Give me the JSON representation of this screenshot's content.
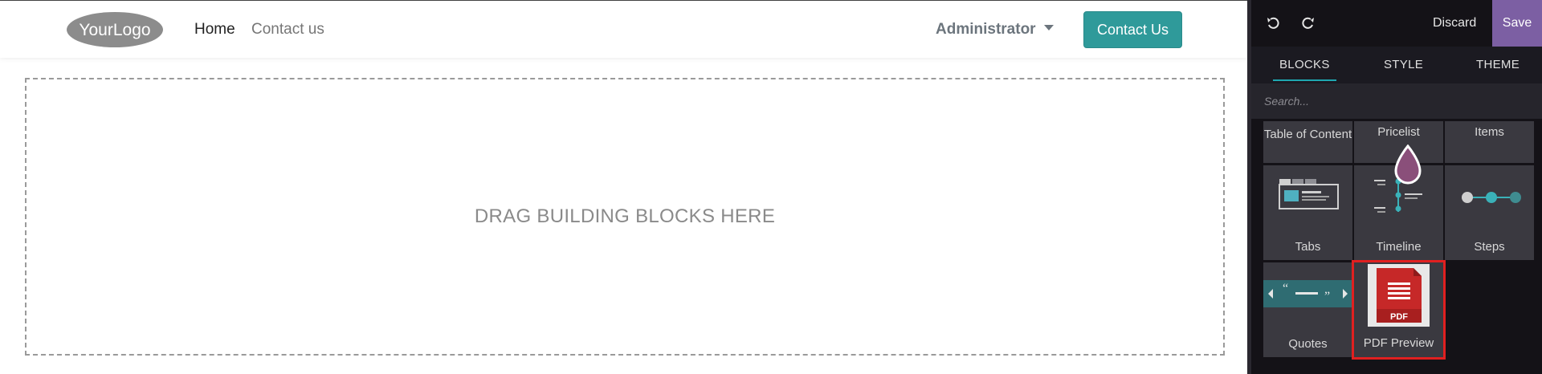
{
  "site": {
    "logo_text": "YourLogo",
    "nav": {
      "home": "Home",
      "contact": "Contact us",
      "user": "Administrator",
      "cta": "Contact Us"
    },
    "dropzone_text": "DRAG BUILDING BLOCKS HERE"
  },
  "editor": {
    "discard_label": "Discard",
    "save_label": "Save",
    "tabs": {
      "blocks": "BLOCKS",
      "style": "STYLE",
      "theme": "THEME"
    },
    "search_placeholder": "Search...",
    "blocks": {
      "toc": "Table of Content",
      "pricelist": "Pricelist",
      "items": "Items",
      "tabs": "Tabs",
      "timeline": "Timeline",
      "steps": "Steps",
      "quotes": "Quotes",
      "pdf": "PDF Preview",
      "pdf_badge": "PDF"
    },
    "highlighted_block": "PDF Preview"
  },
  "colors": {
    "cta": "#2f9a9a",
    "save": "#7c5fa3",
    "active_tab": "#1fa7b0",
    "highlight": "#e02020",
    "editor_bg": "#141217"
  }
}
